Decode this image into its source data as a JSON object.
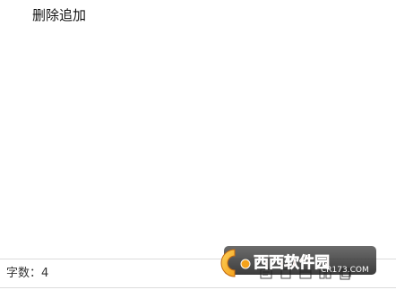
{
  "editor": {
    "text": "删除追加"
  },
  "statusbar": {
    "word_count": "字数：4"
  },
  "watermark": {
    "brand": "西西软件园",
    "site": "CR173.COM"
  },
  "icons": {
    "view_icons": [
      "view-icon-a",
      "view-icon-b",
      "view-icon-c",
      "view-icon-d",
      "view-icon-e"
    ]
  },
  "colors": {
    "watermark_orange": "#f5a21b",
    "watermark_red": "#e8502e",
    "watermark_blue": "#2a6db6"
  }
}
